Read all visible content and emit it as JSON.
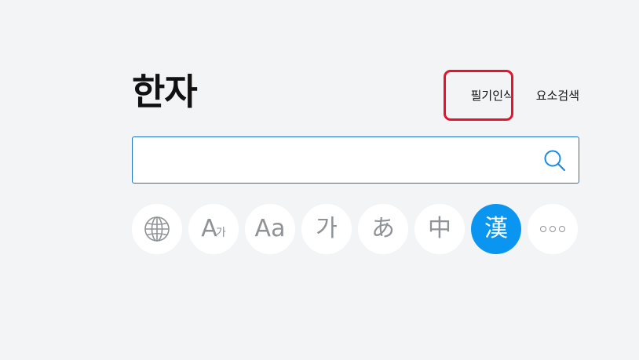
{
  "header": {
    "title": "한자",
    "links": {
      "handwriting": "필기인식",
      "radical_search": "요소검색"
    }
  },
  "search": {
    "value": "",
    "placeholder": "",
    "button_icon": "search-icon"
  },
  "dictionaries": [
    {
      "name": "globe-icon",
      "label": ""
    },
    {
      "name": "translate-icon",
      "label": "A",
      "sub": "가"
    },
    {
      "name": "english-icon",
      "label": "Aa"
    },
    {
      "name": "korean-icon",
      "label": "가"
    },
    {
      "name": "japanese-icon",
      "label": "あ"
    },
    {
      "name": "chinese-icon",
      "label": "中"
    },
    {
      "name": "hanja-icon",
      "label": "漢",
      "active": true
    },
    {
      "name": "more-icon",
      "label": ""
    }
  ],
  "colors": {
    "accent": "#0a95f1",
    "highlight": "#e8132b",
    "search_border": "#1a73c9"
  }
}
